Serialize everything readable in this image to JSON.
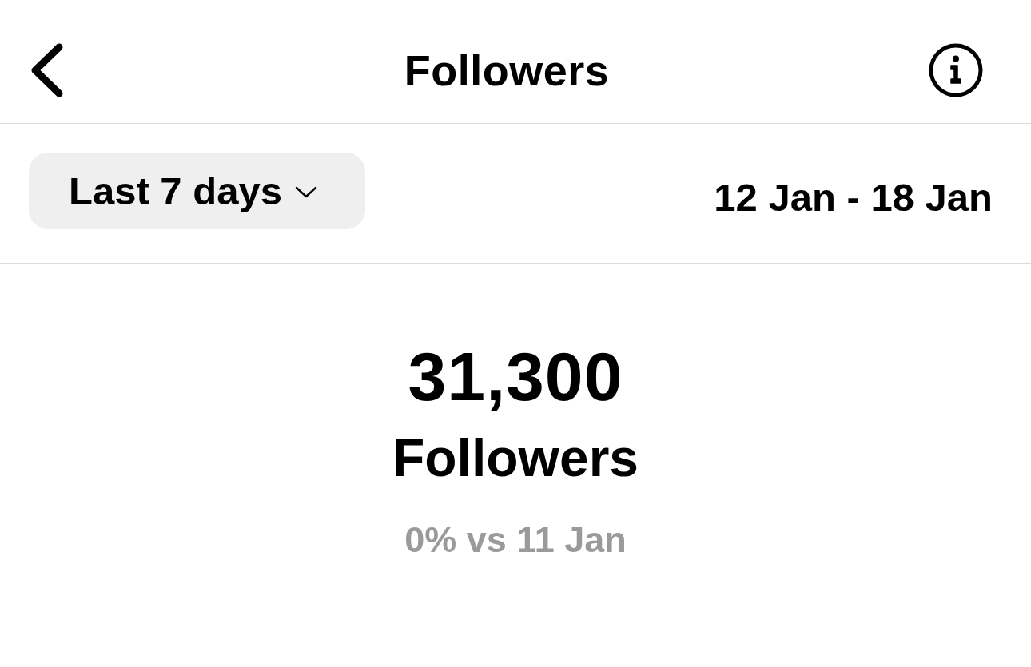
{
  "header": {
    "title": "Followers"
  },
  "filter": {
    "period": "Last 7 days",
    "date_range": "12 Jan - 18 Jan"
  },
  "summary": {
    "value": "31,300",
    "label": "Followers",
    "comparison": "0% vs 11 Jan"
  }
}
